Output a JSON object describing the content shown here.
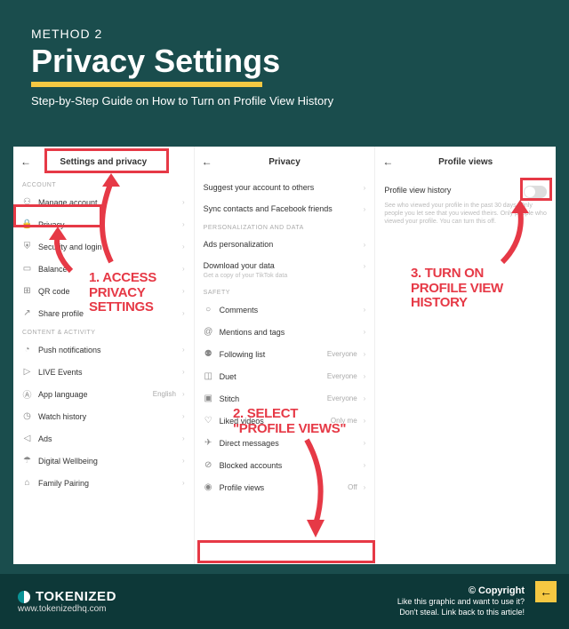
{
  "header": {
    "method": "METHOD 2",
    "title": "Privacy Settings",
    "subtitle": "Step-by-Step Guide on How to Turn on Profile View History"
  },
  "panel1": {
    "title": "Settings and privacy",
    "section_account": "ACCOUNT",
    "manage_account": "Manage account",
    "privacy": "Privacy",
    "security": "Security and login",
    "balance": "Balance",
    "qr": "QR code",
    "share": "Share profile",
    "section_content": "CONTENT & ACTIVITY",
    "push": "Push notifications",
    "live": "LIVE Events",
    "language": "App language",
    "language_val": "English",
    "watch": "Watch history",
    "ads": "Ads",
    "wellbeing": "Digital Wellbeing",
    "family": "Family Pairing"
  },
  "panel2": {
    "title": "Privacy",
    "suggest": "Suggest your account to others",
    "sync": "Sync contacts and Facebook friends",
    "section_personalization": "PERSONALIZATION AND DATA",
    "ads_pers": "Ads personalization",
    "download": "Download your data",
    "download_sub": "Get a copy of your TikTok data",
    "section_safety": "SAFETY",
    "comments": "Comments",
    "mentions": "Mentions and tags",
    "following": "Following list",
    "following_val": "Everyone",
    "duet": "Duet",
    "duet_val": "Everyone",
    "stitch": "Stitch",
    "stitch_val": "Everyone",
    "liked": "Liked videos",
    "liked_val": "Only me",
    "dm": "Direct messages",
    "blocked": "Blocked accounts",
    "profile_views": "Profile views",
    "profile_views_val": "Off"
  },
  "panel3": {
    "title": "Profile views",
    "toggle_label": "Profile view history",
    "toggle_desc": "See who viewed your profile in the past 30 days. Only people you let see that you viewed theirs. Only people who viewed your profile. You can turn this off."
  },
  "annotations": {
    "step1": "1. ACCESS\nPRIVACY\nSETTINGS",
    "step2": "2. SELECT\n\"PROFILE VIEWS\"",
    "step3": "3. TURN ON\nPROFILE VIEW\nHISTORY"
  },
  "footer": {
    "brand": "TOKENIZED",
    "url": "www.tokenizedhq.com",
    "copyright": "© Copyright",
    "copy1": "Like this graphic and want to use it?",
    "copy2": "Don't steal. Link back to this article!"
  }
}
